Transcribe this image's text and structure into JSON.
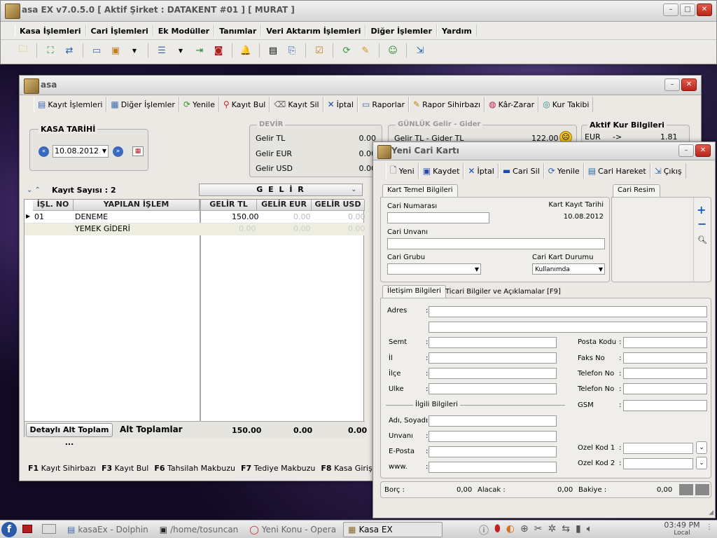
{
  "main": {
    "title": "asa EX v7.0.5.0  [ Aktif Şirket : DATAKENT #01 ] [ MURAT ]",
    "menu": [
      "Kasa İşlemleri",
      "Cari İşlemleri",
      "Ek Modüller",
      "Tanımlar",
      "Veri Aktarım İşlemleri",
      "Diğer İşlemler",
      "Yardım"
    ]
  },
  "kasa": {
    "title": "asa",
    "toolbar": [
      "Kayıt İşlemleri",
      "Diğer İşlemler",
      "Yenile",
      "Kayıt Bul",
      "Kayıt Sil",
      "İptal",
      "Raporlar",
      "Rapor Sihirbazı",
      "Kâr-Zarar",
      "Kur Takibi"
    ],
    "date_group_title": "KASA TARİHİ",
    "date_value": "10.08.2012",
    "devir_title": "DEVİR",
    "devir_rows": [
      {
        "label": "Gelir TL",
        "value": "0.00"
      },
      {
        "label": "Gelir EUR",
        "value": "0.00"
      },
      {
        "label": "Gelir USD",
        "value": "0.00"
      }
    ],
    "gunluk_title": "GÜNLÜK Gelir - Gider",
    "gunluk_label": "Gelir TL - Gider TL",
    "gunluk_value": "122.00",
    "kur_title": "Aktif Kur Bilgileri",
    "kur_row": {
      "label": "EUR",
      "arrow": "->",
      "value": "1.81"
    },
    "record_count": "Kayıt Sayısı : 2",
    "gelir_header": "G E L İ R",
    "columns": [
      "İŞL. NO",
      "YAPILAN İŞLEM",
      "GELİR TL",
      "GELİR EUR",
      "GELİR USD"
    ],
    "rows": [
      {
        "no": "01",
        "islem": "DENEME",
        "tl": "150.00",
        "eur": "0.00",
        "usd": "0.00"
      },
      {
        "no": "",
        "islem": "YEMEK GİDERİ",
        "tl": "0.00",
        "eur": "0.00",
        "usd": "0.00"
      }
    ],
    "alt_button": "Detaylı Alt Toplam ...",
    "alt_label": "Alt Toplamlar",
    "alt_totals": [
      "150.00",
      "0.00",
      "0.00"
    ],
    "shortcuts": [
      {
        "key": "F1",
        "label": "Kayıt Sihirbazı"
      },
      {
        "key": "F3",
        "label": "Kayıt Bul"
      },
      {
        "key": "F6",
        "label": "Tahsilah Makbuzu"
      },
      {
        "key": "F7",
        "label": "Tediye Makbuzu"
      },
      {
        "key": "F8",
        "label": "Kasa Giriş Ekranı"
      }
    ]
  },
  "cari": {
    "title": "Yeni Cari Kartı",
    "toolbar": [
      "Yeni",
      "Kaydet",
      "İptal",
      "Cari Sil",
      "Yenile",
      "Cari Hareket",
      "Çıkış"
    ],
    "tab_temel": "Kart Temel Bilgileri",
    "tab_resim": "Cari Resim",
    "cari_numarasi": "Cari Numarası",
    "kayit_tarihi_label": "Kart Kayıt Tarihi",
    "kayit_tarihi": "10.08.2012",
    "cari_unvani": "Cari Unvanı",
    "cari_grubu": "Cari Grubu",
    "kart_durumu": "Cari Kart Durumu",
    "kart_durumu_value": "Kullanımda",
    "tab_iletisim": "İletişim Bilgileri",
    "tab_ticari": "Ticari Bilgiler ve Açıklamalar [F9]",
    "adres": "Adres",
    "left_fields": [
      "Semt",
      "İl",
      "İlçe",
      "Ulke"
    ],
    "right_fields": [
      "Posta Kodu",
      "Faks No",
      "Telefon No",
      "Telefon No",
      "GSM"
    ],
    "ilgili_title": "İlgili Bilgileri",
    "ilgili_fields": [
      "Adı, Soyadı",
      "Unvanı",
      "E-Posta",
      "www."
    ],
    "ozel_kod_1": "Ozel Kod 1",
    "ozel_kod_2": "Ozel Kod 2",
    "borc_label": "Borç :",
    "borc_value": "0,00",
    "alacak_label": "Alacak :",
    "alacak_value": "0,00",
    "bakiye_label": "Bakiye :",
    "bakiye_value": "0,00"
  },
  "taskbar": {
    "tasks": [
      "kasaEx - Dolphin",
      "/home/tosuncan",
      "Yeni Konu - Opera",
      "Kasa EX"
    ],
    "time": "03:49 PM",
    "locale": "Local"
  }
}
